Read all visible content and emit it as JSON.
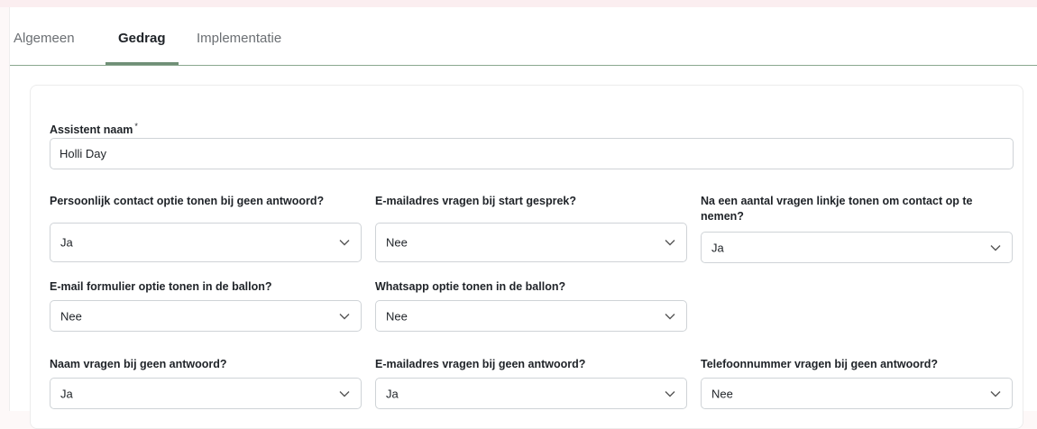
{
  "tabs": [
    {
      "label": "Algemeen"
    },
    {
      "label": "Gedrag"
    },
    {
      "label": "Implementatie"
    }
  ],
  "active_tab": "Gedrag",
  "form": {
    "assistant_name": {
      "label": "Assistent naam",
      "required_mark": "*",
      "value": "Holli Day"
    },
    "fields": [
      {
        "label": "Persoonlijk contact optie tonen bij geen antwoord?",
        "value": "Ja"
      },
      {
        "label": "E-mailadres vragen bij start gesprek?",
        "value": "Nee"
      },
      {
        "label": "Na een aantal vragen linkje tonen om contact op te nemen?",
        "value": "Ja"
      },
      {
        "label": "E-mail formulier optie tonen in de ballon?",
        "value": "Nee"
      },
      {
        "label": "Whatsapp optie tonen in de ballon?",
        "value": "Nee"
      },
      {
        "label": "Naam vragen bij geen antwoord?",
        "value": "Ja"
      },
      {
        "label": "E-mailadres vragen bij geen antwoord?",
        "value": "Ja"
      },
      {
        "label": "Telefoonnummer vragen bij geen antwoord?",
        "value": "Nee"
      }
    ]
  },
  "colors": {
    "accent": "#6f8f76",
    "border": "#cfd3d7"
  },
  "icons": {
    "select_arrow": "chevron-down-icon"
  }
}
